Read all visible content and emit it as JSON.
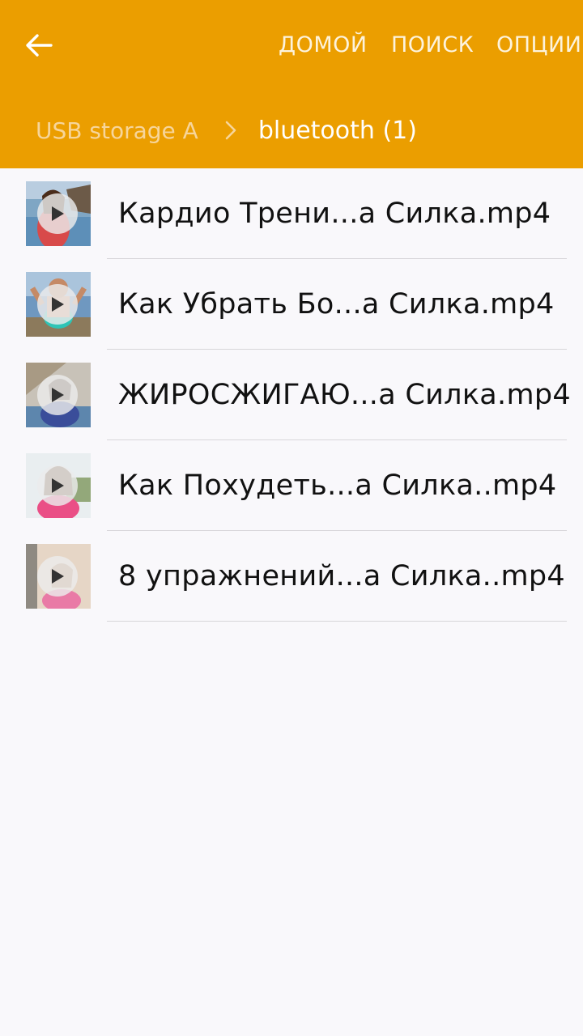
{
  "toolbar": {
    "back_icon": "arrow-left-icon",
    "actions": {
      "home": "ДОМОЙ",
      "search": "ПОИСК",
      "options": "ОПЦИИ"
    }
  },
  "breadcrumb": {
    "root": "USB storage A",
    "separator_icon": "chevron-right-icon",
    "current": "bluetooth (1)"
  },
  "files": [
    {
      "name": "Кардио Трени...а Силка.mp4",
      "thumb_icon": "play-icon"
    },
    {
      "name": "Как Убрать Бо...а Силка.mp4",
      "thumb_icon": "play-icon"
    },
    {
      "name": "ЖИРОСЖИГАЮ...а Силка.mp4",
      "thumb_icon": "play-icon"
    },
    {
      "name": "Как Похудеть...а Силка..mp4",
      "thumb_icon": "play-icon"
    },
    {
      "name": "8 упражнений...а Силка..mp4",
      "thumb_icon": "play-icon"
    }
  ],
  "colors": {
    "accent": "#eb9e00",
    "background": "#f9f8fb",
    "divider": "#d8d6da"
  }
}
